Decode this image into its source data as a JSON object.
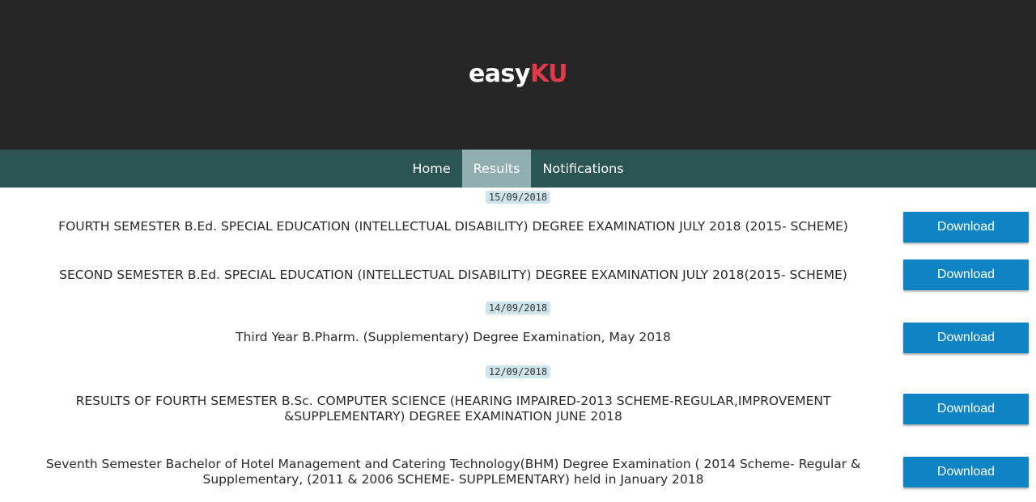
{
  "brand": {
    "part1": "easy",
    "part2": "KU"
  },
  "nav": {
    "items": [
      {
        "label": "Home"
      },
      {
        "label": "Results"
      },
      {
        "label": "Notifications"
      }
    ]
  },
  "dates": [
    "15/09/2018",
    "14/09/2018",
    "12/09/2018"
  ],
  "results": [
    {
      "title": "FOURTH SEMESTER B.Ed. SPECIAL EDUCATION (INTELLECTUAL DISABILITY) DEGREE EXAMINATION JULY 2018 (2015- SCHEME)",
      "button": "Download"
    },
    {
      "title": "SECOND SEMESTER B.Ed. SPECIAL EDUCATION (INTELLECTUAL DISABILITY) DEGREE EXAMINATION JULY 2018(2015- SCHEME)",
      "button": "Download"
    },
    {
      "title": "Third Year B.Pharm. (Supplementary) Degree Examination, May 2018",
      "button": "Download"
    },
    {
      "title": "RESULTS OF FOURTH SEMESTER B.Sc. COMPUTER SCIENCE (HEARING IMPAIRED-2013 SCHEME-REGULAR,IMPROVEMENT &SUPPLEMENTARY) DEGREE EXAMINATION JUNE 2018",
      "button": "Download"
    },
    {
      "title": "Seventh Semester Bachelor of Hotel Management and Catering Technology(BHM) Degree Examination ( 2014 Scheme- Regular & Supplementary, (2011 & 2006 SCHEME- SUPPLEMENTARY) held in January 2018",
      "button": "Download"
    }
  ],
  "colors": {
    "header_bg": "#262626",
    "brand_accent": "#e0394a",
    "nav_bg": "#2b5553",
    "nav_active": "#90aeb0",
    "button": "#0f84c4",
    "date_badge": "#cfe5ec"
  }
}
